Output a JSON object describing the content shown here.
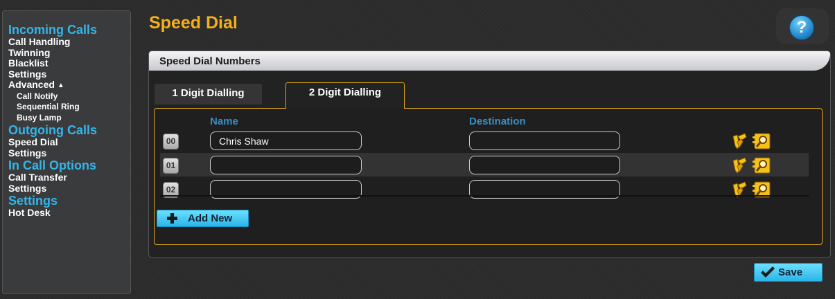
{
  "sidebar": {
    "sections": [
      {
        "heading": "Incoming Calls",
        "items": [
          "Call Handling",
          "Twinning",
          "Blacklist",
          "Settings"
        ]
      },
      {
        "advanced_label": "Advanced",
        "advanced_icon": "triangle-up-icon",
        "subitems": [
          "Call Notify",
          "Sequential Ring",
          "Busy Lamp"
        ]
      },
      {
        "heading": "Outgoing Calls",
        "items": [
          "Speed Dial",
          "Settings"
        ]
      },
      {
        "heading": "In Call Options",
        "items": [
          "Call Transfer",
          "Settings"
        ]
      },
      {
        "heading": "Settings",
        "items": [
          "Hot Desk"
        ]
      }
    ]
  },
  "page": {
    "title": "Speed Dial",
    "help_glyph": "?",
    "help_icon": "help-icon"
  },
  "panel": {
    "title": "Speed Dial Numbers",
    "tabs": [
      {
        "label": "1 Digit Dialling",
        "active": false
      },
      {
        "label": "2 Digit Dialling",
        "active": true
      }
    ],
    "columns": {
      "name": "Name",
      "destination": "Destination"
    },
    "rows": [
      {
        "num": "00",
        "name": "Chris Shaw",
        "destination": ""
      },
      {
        "num": "01",
        "name": "",
        "destination": ""
      },
      {
        "num": "02",
        "name": "",
        "destination": ""
      }
    ],
    "row_icons": [
      "edit-icon",
      "lookup-icon"
    ],
    "add_label": "Add New"
  },
  "footer": {
    "save_label": "Save"
  },
  "colors": {
    "accent_blue": "#35b5ea",
    "title_orange": "#f3b01e",
    "tab_border": "#e1a91f",
    "button_cyan": "#2bb4e8"
  }
}
